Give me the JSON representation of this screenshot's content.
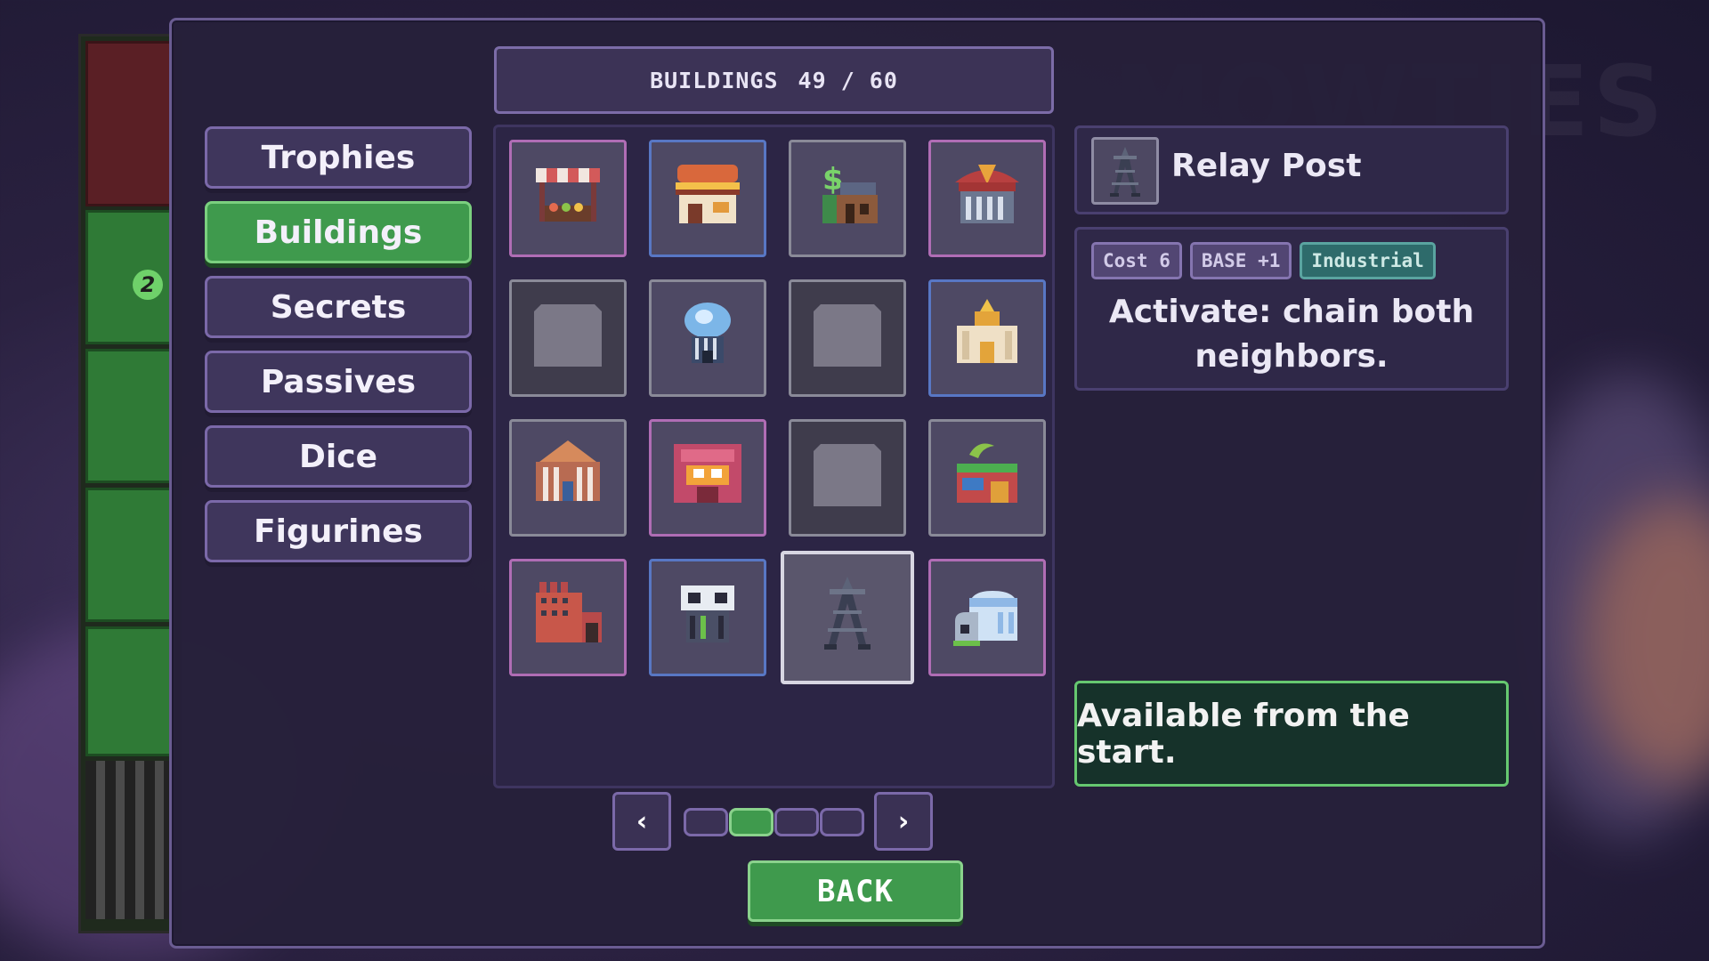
{
  "background": {
    "faded_title": "MOWTIES"
  },
  "side_board": {
    "badge_number": "2"
  },
  "header": {
    "section_label": "BUILDINGS",
    "count_label": "49 / 60"
  },
  "tabs": [
    {
      "label": "Trophies",
      "active": false
    },
    {
      "label": "Buildings",
      "active": true
    },
    {
      "label": "Secrets",
      "active": false
    },
    {
      "label": "Passives",
      "active": false
    },
    {
      "label": "Dice",
      "active": false
    },
    {
      "label": "Figurines",
      "active": false
    }
  ],
  "grid": {
    "cells": [
      {
        "icon": "market-stall-icon",
        "state": "unlocked"
      },
      {
        "icon": "burger-shop-icon",
        "state": "unlocked"
      },
      {
        "icon": "bank-icon",
        "state": "unlocked"
      },
      {
        "icon": "pizza-shop-icon",
        "state": "unlocked"
      },
      {
        "icon": "locked-building-icon",
        "state": "locked"
      },
      {
        "icon": "jellyfish-tower-icon",
        "state": "unlocked"
      },
      {
        "icon": "locked-building-icon",
        "state": "locked"
      },
      {
        "icon": "temple-icon",
        "state": "unlocked"
      },
      {
        "icon": "cathedral-icon",
        "state": "unlocked"
      },
      {
        "icon": "arcade-icon",
        "state": "unlocked"
      },
      {
        "icon": "locked-building-icon",
        "state": "locked"
      },
      {
        "icon": "greenhouse-icon",
        "state": "unlocked"
      },
      {
        "icon": "factory-icon",
        "state": "unlocked"
      },
      {
        "icon": "robot-shop-icon",
        "state": "unlocked"
      },
      {
        "icon": "relay-tower-icon",
        "state": "selected"
      },
      {
        "icon": "igloo-icon",
        "state": "unlocked"
      }
    ]
  },
  "pager": {
    "prev_symbol": "‹",
    "next_symbol": "›",
    "total_pages": 4,
    "current_page": 2
  },
  "back_button": {
    "label": "BACK"
  },
  "detail": {
    "name": "Relay Post",
    "icon": "relay-tower-icon",
    "tags": [
      {
        "kind": "cost",
        "label": "Cost 6"
      },
      {
        "kind": "base",
        "label": "BASE +1"
      },
      {
        "kind": "ind",
        "label": "Industrial"
      }
    ],
    "description": "Activate: chain both neighbors.",
    "availability": "Available from the start."
  },
  "colors": {
    "accent_green": "#3f9a4d",
    "panel_border": "#7b69a9",
    "industrial_tag": "#2e6b6b"
  }
}
